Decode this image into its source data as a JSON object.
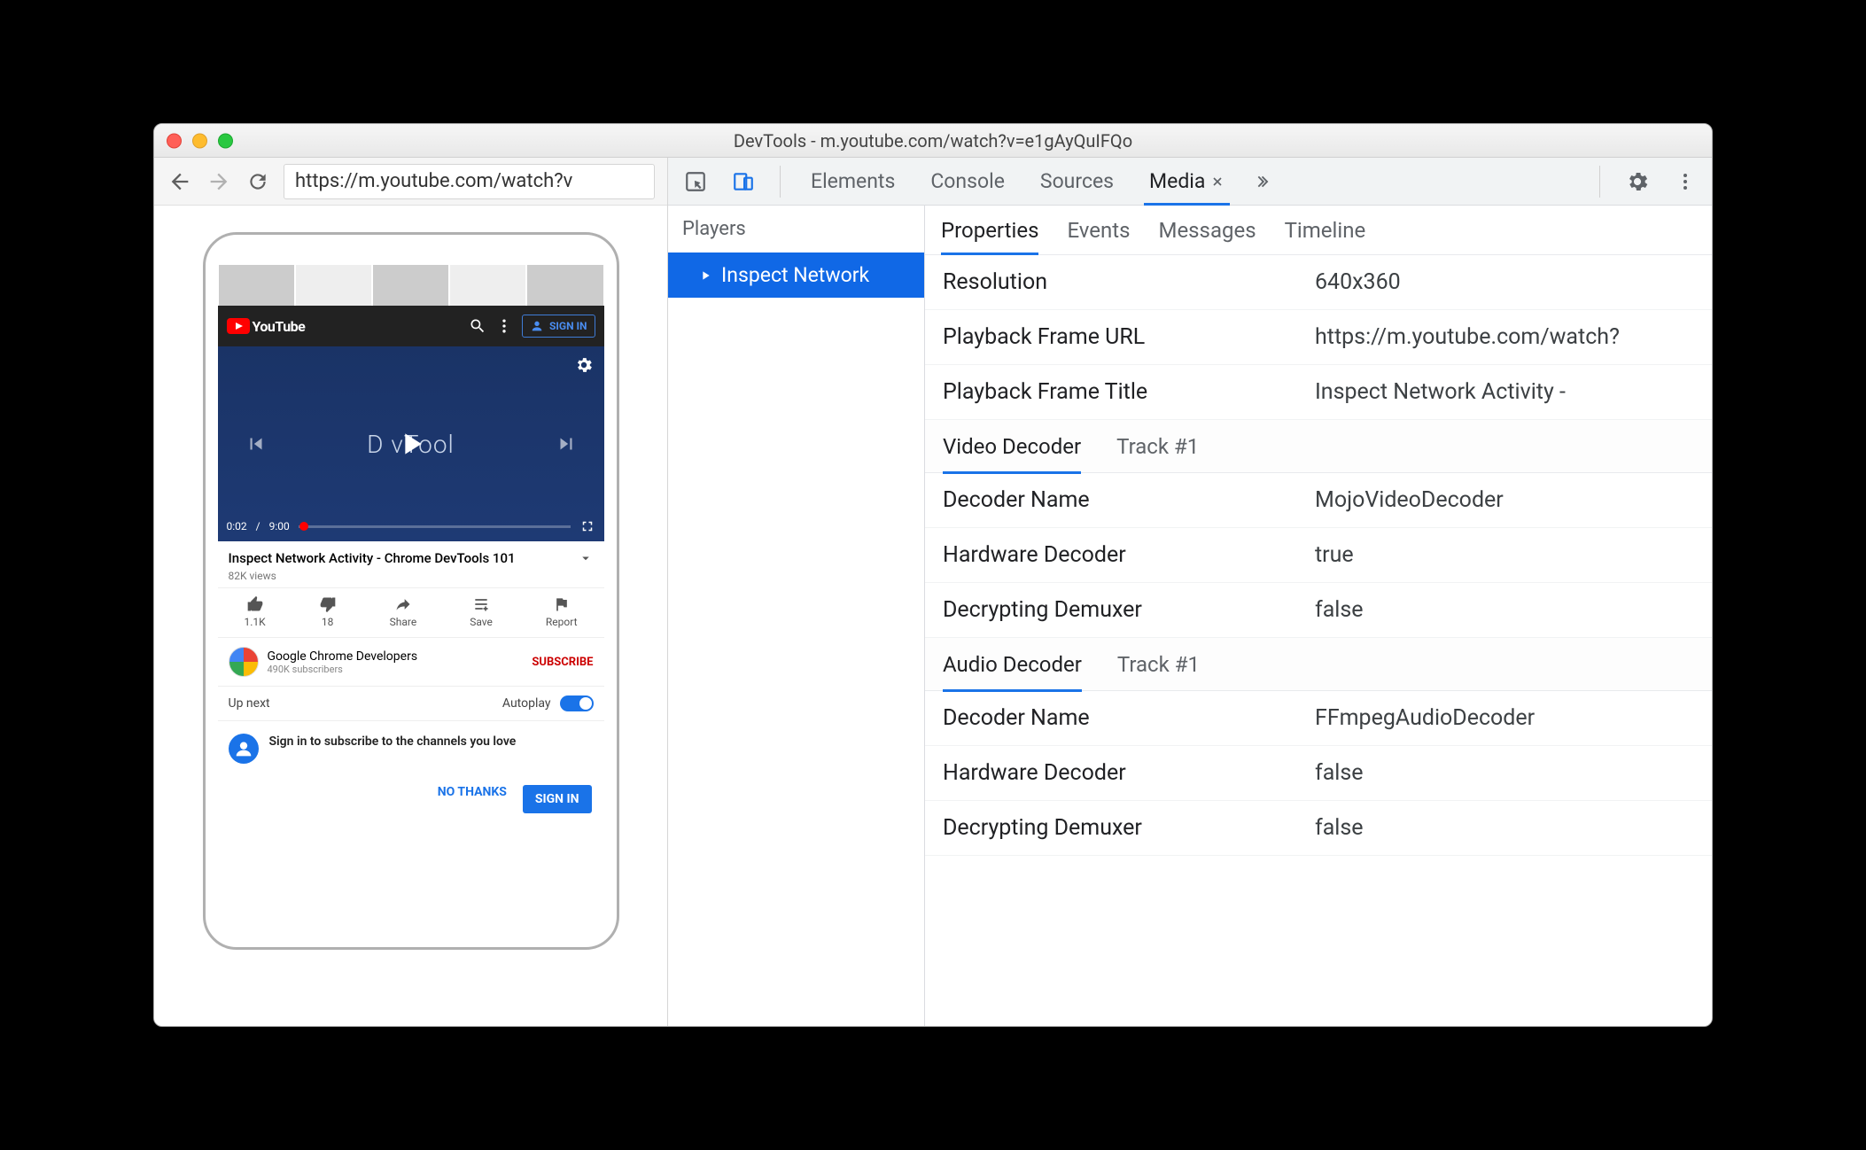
{
  "window": {
    "title": "DevTools - m.youtube.com/watch?v=e1gAyQuIFQo"
  },
  "browser": {
    "address": "https://m.youtube.com/watch?v"
  },
  "youtube": {
    "topbarBrand": "YouTube",
    "signInLabel": "SIGN IN",
    "playerOverlay": "D  vTool",
    "timeCurrent": "0:02",
    "timeTotal": "9:00",
    "videoTitle": "Inspect Network Activity - Chrome DevTools 101",
    "views": "82K views",
    "actions": {
      "like": "1.1K",
      "dislike": "18",
      "share": "Share",
      "save": "Save",
      "report": "Report"
    },
    "channelName": "Google Chrome Developers",
    "channelSubs": "490K subscribers",
    "subscribeLabel": "SUBSCRIBE",
    "upNextLabel": "Up next",
    "autoplayLabel": "Autoplay",
    "signinPromptText": "Sign in to subscribe to the channels you love",
    "noThanks": "NO THANKS",
    "signInButton": "SIGN IN"
  },
  "devtools": {
    "tabs": {
      "elements": "Elements",
      "console": "Console",
      "sources": "Sources",
      "media": "Media"
    },
    "subTabs": {
      "properties": "Properties",
      "events": "Events",
      "messages": "Messages",
      "timeline": "Timeline"
    },
    "players": {
      "header": "Players",
      "selected": "Inspect Network"
    },
    "properties": {
      "resolutionLabel": "Resolution",
      "resolutionValue": "640x360",
      "playbackFrameUrlLabel": "Playback Frame URL",
      "playbackFrameUrlValue": "https://m.youtube.com/watch?",
      "playbackFrameTitleLabel": "Playback Frame Title",
      "playbackFrameTitleValue": "Inspect Network Activity -"
    },
    "sections": {
      "videoDecoder": "Video Decoder",
      "audioDecoder": "Audio Decoder",
      "track": "Track #1"
    },
    "videoDecoder": {
      "decoderNameLabel": "Decoder Name",
      "decoderNameValue": "MojoVideoDecoder",
      "hardwareDecoderLabel": "Hardware Decoder",
      "hardwareDecoderValue": "true",
      "decryptingDemuxerLabel": "Decrypting Demuxer",
      "decryptingDemuxerValue": "false"
    },
    "audioDecoder": {
      "decoderNameLabel": "Decoder Name",
      "decoderNameValue": "FFmpegAudioDecoder",
      "hardwareDecoderLabel": "Hardware Decoder",
      "hardwareDecoderValue": "false",
      "decryptingDemuxerLabel": "Decrypting Demuxer",
      "decryptingDemuxerValue": "false"
    }
  }
}
